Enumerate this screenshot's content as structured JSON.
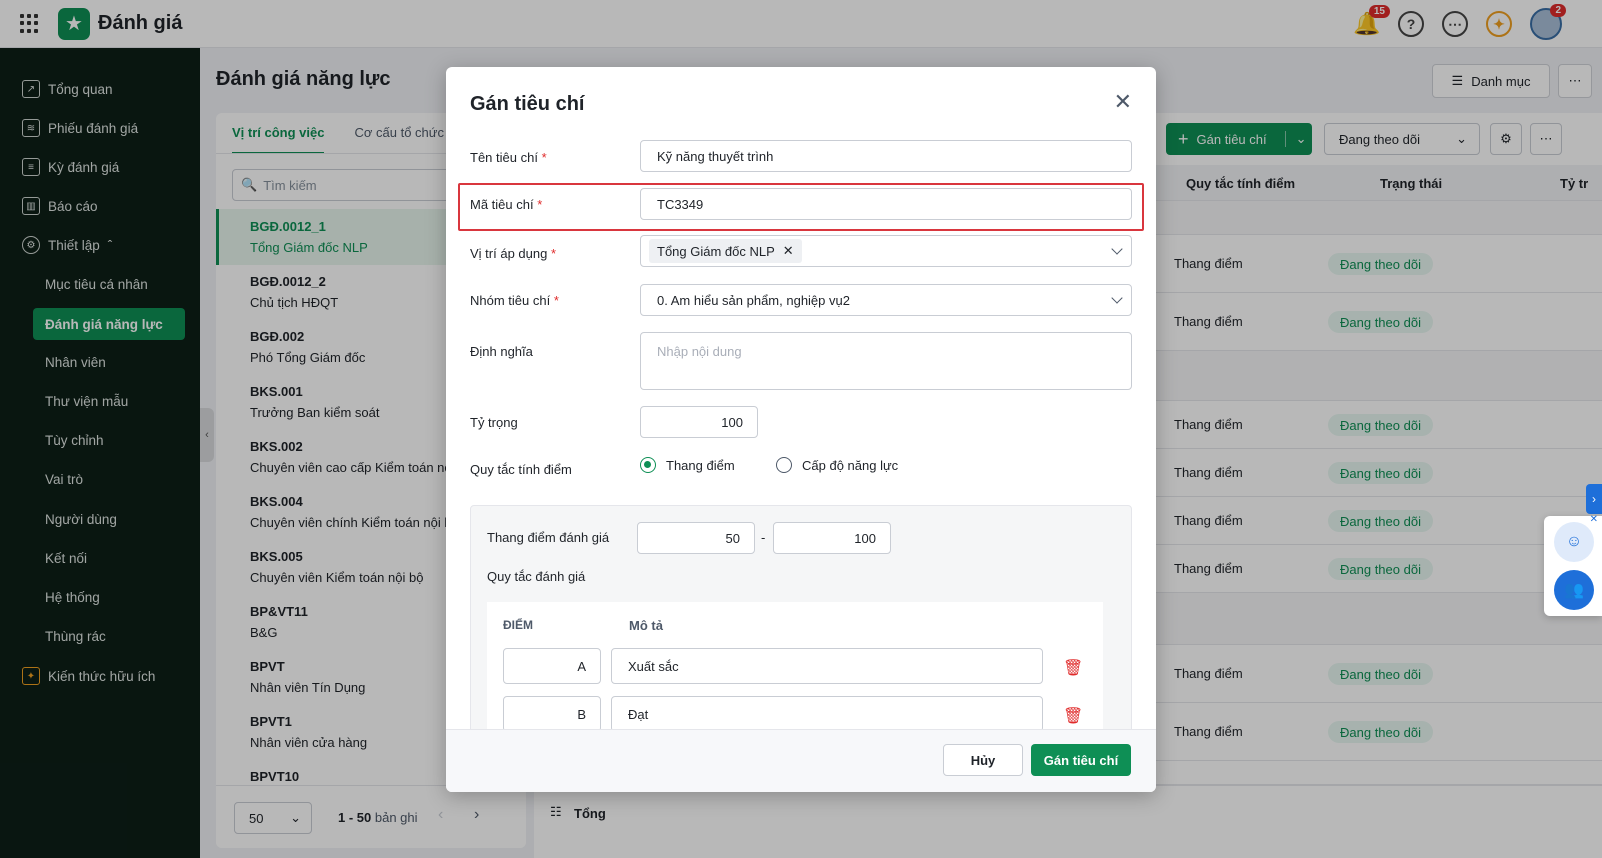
{
  "app": {
    "title": "Đánh giá"
  },
  "top": {
    "notif_count": "15",
    "avatar_count": "2"
  },
  "sidebar": {
    "items": [
      {
        "label": "Tổng quan"
      },
      {
        "label": "Phiếu đánh giá"
      },
      {
        "label": "Kỳ đánh giá"
      },
      {
        "label": "Báo cáo"
      },
      {
        "label": "Thiết lập"
      }
    ],
    "sub": [
      "Mục tiêu cá nhân",
      "Đánh giá năng lực",
      "Nhân viên",
      "Thư viện mẫu",
      "Tùy chỉnh",
      "Vai trò",
      "Người dùng",
      "Kết nối",
      "Hệ thống",
      "Thùng rác"
    ],
    "bottom": "Kiến thức hữu ích"
  },
  "page": {
    "title": "Đánh giá năng lực",
    "category_btn": "Danh mục"
  },
  "left": {
    "tabs": [
      "Vị trí công việc",
      "Cơ cấu tổ chức"
    ],
    "search_placeholder": "Tìm kiếm",
    "positions": [
      {
        "code": "BGĐ.0012_1",
        "name": "Tổng Giám đốc NLP"
      },
      {
        "code": "BGĐ.0012_2",
        "name": "Chủ tịch HĐQT"
      },
      {
        "code": "BGĐ.002",
        "name": "Phó Tổng Giám đốc"
      },
      {
        "code": "BKS.001",
        "name": "Trưởng Ban kiểm soát"
      },
      {
        "code": "BKS.002",
        "name": "Chuyên viên cao cấp Kiểm toán nộ"
      },
      {
        "code": "BKS.004",
        "name": "Chuyên viên chính Kiểm toán nội b"
      },
      {
        "code": "BKS.005",
        "name": "Chuyên viên Kiểm toán nội bộ"
      },
      {
        "code": "BP&VT11",
        "name": "B&G"
      },
      {
        "code": "BPVT",
        "name": "Nhân viên Tín Dụng"
      },
      {
        "code": "BPVT1",
        "name": "Nhân viên cửa hàng"
      },
      {
        "code": "BPVT10",
        "name": ""
      }
    ],
    "page_size": "50",
    "range_text": "1 - 50",
    "range_suffix": "bản ghi"
  },
  "right": {
    "assign_btn": "Gán tiêu chí",
    "filter": "Đang theo dõi",
    "headers": [
      "Quy tắc tính điểm",
      "Trạng thái",
      "Tỷ tr"
    ],
    "rule_text": "Thang điểm",
    "status_text": "Đang theo dõi",
    "footer": "Tổng"
  },
  "modal": {
    "title": "Gán tiêu chí",
    "fields": {
      "name_label": "Tên tiêu chí",
      "name_value": "Kỹ năng thuyết trình",
      "code_label": "Mã tiêu chí",
      "code_value": "TC3349",
      "position_label": "Vị trí áp dụng",
      "position_chip": "Tổng Giám đốc NLP",
      "group_label": "Nhóm tiêu chí",
      "group_value": "0. Am hiểu sản phẩm, nghiệp vụ2",
      "def_label": "Định nghĩa",
      "def_placeholder": "Nhập nội dung",
      "weight_label": "Tỷ trọng",
      "weight_value": "100",
      "rule_label": "Quy tắc tính điểm",
      "rule_opt1": "Thang điểm",
      "rule_opt2": "Cấp độ năng lực",
      "required_mark": "*"
    },
    "scale": {
      "label": "Thang điểm đánh giá",
      "min": "50",
      "max": "100",
      "dash": "-",
      "rules_label": "Quy tắc đánh giá",
      "col_score": "ĐIỂM",
      "col_desc": "Mô tả",
      "rows": [
        {
          "score": "A",
          "desc": "Xuất sắc"
        },
        {
          "score": "B",
          "desc": "Đạt"
        }
      ]
    },
    "cancel": "Hủy",
    "submit": "Gán tiêu chí"
  }
}
